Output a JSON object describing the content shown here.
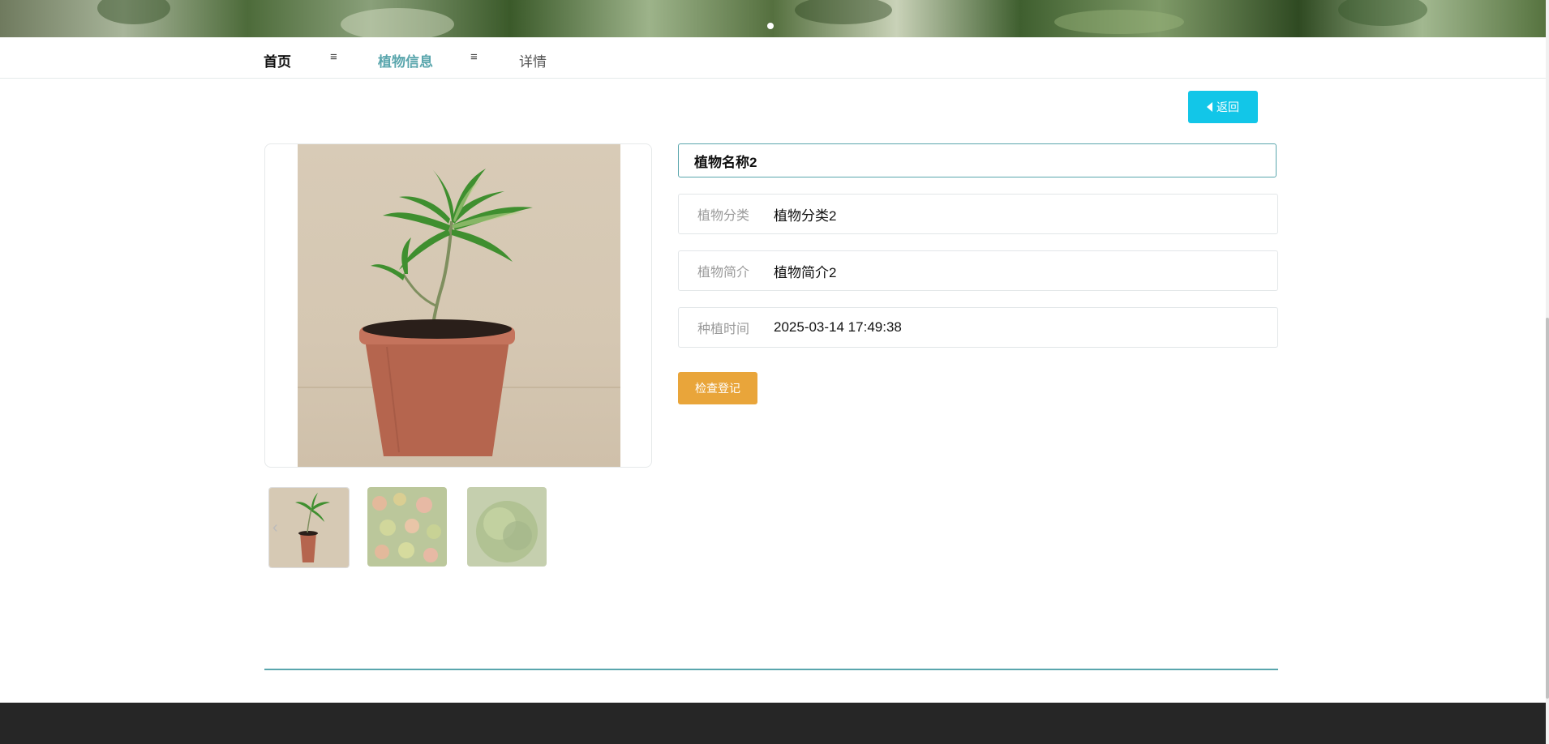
{
  "breadcrumb": {
    "home": "首页",
    "separator": "≡",
    "plant_info": "植物信息",
    "detail": "详情"
  },
  "back_button": {
    "label": "返回",
    "icon": "caret-left-icon"
  },
  "plant": {
    "name": "植物名称2",
    "fields": [
      {
        "label": "植物分类",
        "value": "植物分类2"
      },
      {
        "label": "植物简介",
        "value": "植物简介2"
      },
      {
        "label": "种植时间",
        "value": "2025-03-14 17:49:38"
      }
    ]
  },
  "actions": {
    "check_register": "检查登记"
  },
  "gallery": {
    "prev_icon": "chevron-left-icon",
    "thumbnail_count": 3
  },
  "colors": {
    "accent": "#5aa6ad",
    "back_button": "#12c6e8",
    "check_button": "#e9a53a",
    "footer": "#262626"
  }
}
